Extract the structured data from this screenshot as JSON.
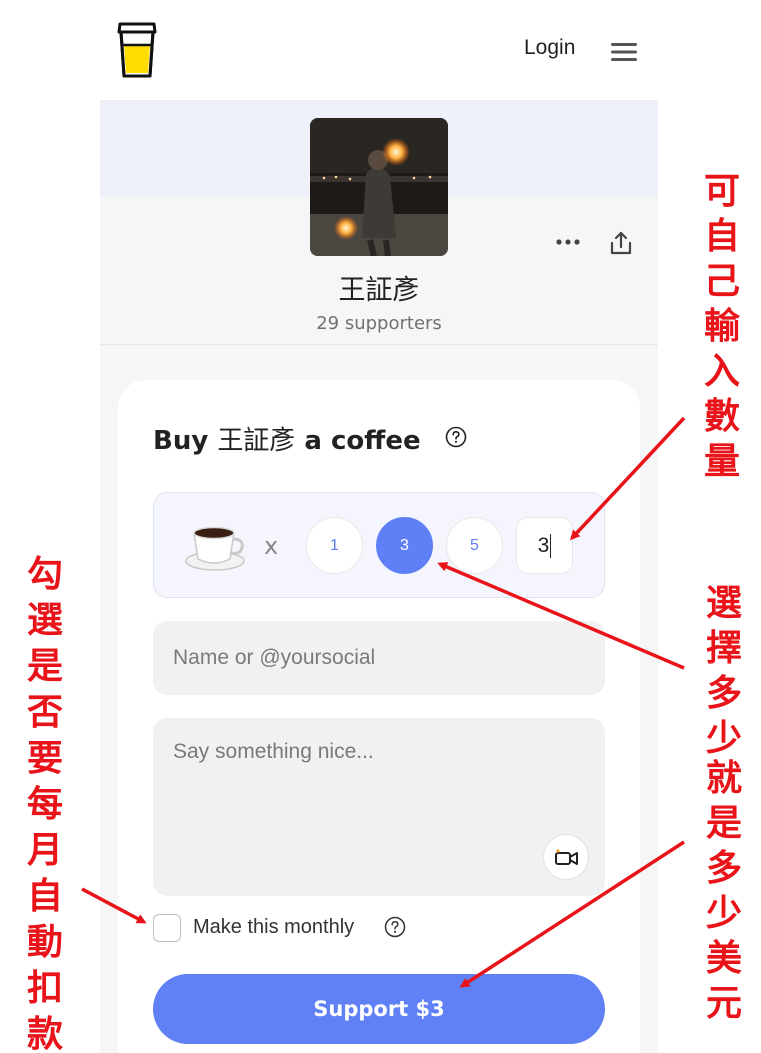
{
  "header": {
    "login_label": "Login",
    "logo_icon": "coffee-cup-logo-icon",
    "menu_icon": "hamburger-menu-icon"
  },
  "profile": {
    "name": "王証彥",
    "supporters": "29 supporters"
  },
  "card": {
    "title_prefix": "Buy ",
    "title_name": "王証彥",
    "title_suffix": " a coffee",
    "item_icon": "coffee-cup-icon",
    "multiplier": "x",
    "quantities": [
      "1",
      "3",
      "5"
    ],
    "selected_quantity": "3",
    "custom_quantity": "3",
    "name_placeholder": "Name or @yoursocial",
    "message_placeholder": "Say something nice...",
    "monthly_label": "Make this monthly",
    "monthly_checked": false,
    "support_button": "Support $3"
  },
  "annotations": {
    "custom_input": "可自己輸入數量",
    "select_amount": "選擇多少",
    "equals_dollars": "就是多少美元",
    "monthly_option": "勾選是否要每月自動扣款"
  },
  "colors": {
    "accent": "#6080f5",
    "annotation": "#e8141a",
    "cover": "#eef0fa"
  }
}
